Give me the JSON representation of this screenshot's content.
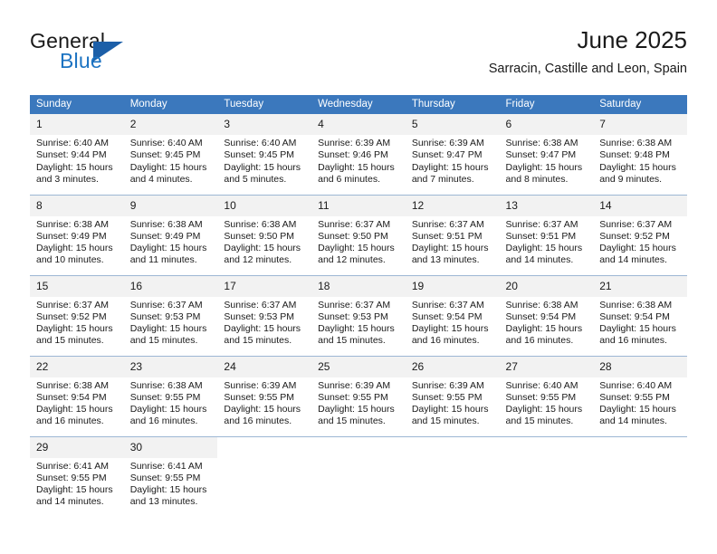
{
  "logo": {
    "word_one": "General",
    "word_two": "Blue",
    "triangle_color": "#1c5fa8",
    "blue_text_color": "#1c73c2"
  },
  "header": {
    "title": "June 2025",
    "subtitle": "Sarracin, Castille and Leon, Spain"
  },
  "theme": {
    "header_bg": "#3b78bd",
    "header_text": "#ffffff",
    "daynum_bg": "#f2f2f2",
    "row_divider": "#9db7d4"
  },
  "calendar": {
    "weekday_headers": [
      "Sunday",
      "Monday",
      "Tuesday",
      "Wednesday",
      "Thursday",
      "Friday",
      "Saturday"
    ],
    "labels": {
      "sunrise_prefix": "Sunrise:",
      "sunset_prefix": "Sunset:",
      "daylight_prefix": "Daylight:"
    },
    "weeks": [
      [
        {
          "day": "1",
          "sunrise": "Sunrise: 6:40 AM",
          "sunset": "Sunset: 9:44 PM",
          "daylight_line1": "Daylight: 15 hours",
          "daylight_line2": "and 3 minutes."
        },
        {
          "day": "2",
          "sunrise": "Sunrise: 6:40 AM",
          "sunset": "Sunset: 9:45 PM",
          "daylight_line1": "Daylight: 15 hours",
          "daylight_line2": "and 4 minutes."
        },
        {
          "day": "3",
          "sunrise": "Sunrise: 6:40 AM",
          "sunset": "Sunset: 9:45 PM",
          "daylight_line1": "Daylight: 15 hours",
          "daylight_line2": "and 5 minutes."
        },
        {
          "day": "4",
          "sunrise": "Sunrise: 6:39 AM",
          "sunset": "Sunset: 9:46 PM",
          "daylight_line1": "Daylight: 15 hours",
          "daylight_line2": "and 6 minutes."
        },
        {
          "day": "5",
          "sunrise": "Sunrise: 6:39 AM",
          "sunset": "Sunset: 9:47 PM",
          "daylight_line1": "Daylight: 15 hours",
          "daylight_line2": "and 7 minutes."
        },
        {
          "day": "6",
          "sunrise": "Sunrise: 6:38 AM",
          "sunset": "Sunset: 9:47 PM",
          "daylight_line1": "Daylight: 15 hours",
          "daylight_line2": "and 8 minutes."
        },
        {
          "day": "7",
          "sunrise": "Sunrise: 6:38 AM",
          "sunset": "Sunset: 9:48 PM",
          "daylight_line1": "Daylight: 15 hours",
          "daylight_line2": "and 9 minutes."
        }
      ],
      [
        {
          "day": "8",
          "sunrise": "Sunrise: 6:38 AM",
          "sunset": "Sunset: 9:49 PM",
          "daylight_line1": "Daylight: 15 hours",
          "daylight_line2": "and 10 minutes."
        },
        {
          "day": "9",
          "sunrise": "Sunrise: 6:38 AM",
          "sunset": "Sunset: 9:49 PM",
          "daylight_line1": "Daylight: 15 hours",
          "daylight_line2": "and 11 minutes."
        },
        {
          "day": "10",
          "sunrise": "Sunrise: 6:38 AM",
          "sunset": "Sunset: 9:50 PM",
          "daylight_line1": "Daylight: 15 hours",
          "daylight_line2": "and 12 minutes."
        },
        {
          "day": "11",
          "sunrise": "Sunrise: 6:37 AM",
          "sunset": "Sunset: 9:50 PM",
          "daylight_line1": "Daylight: 15 hours",
          "daylight_line2": "and 12 minutes."
        },
        {
          "day": "12",
          "sunrise": "Sunrise: 6:37 AM",
          "sunset": "Sunset: 9:51 PM",
          "daylight_line1": "Daylight: 15 hours",
          "daylight_line2": "and 13 minutes."
        },
        {
          "day": "13",
          "sunrise": "Sunrise: 6:37 AM",
          "sunset": "Sunset: 9:51 PM",
          "daylight_line1": "Daylight: 15 hours",
          "daylight_line2": "and 14 minutes."
        },
        {
          "day": "14",
          "sunrise": "Sunrise: 6:37 AM",
          "sunset": "Sunset: 9:52 PM",
          "daylight_line1": "Daylight: 15 hours",
          "daylight_line2": "and 14 minutes."
        }
      ],
      [
        {
          "day": "15",
          "sunrise": "Sunrise: 6:37 AM",
          "sunset": "Sunset: 9:52 PM",
          "daylight_line1": "Daylight: 15 hours",
          "daylight_line2": "and 15 minutes."
        },
        {
          "day": "16",
          "sunrise": "Sunrise: 6:37 AM",
          "sunset": "Sunset: 9:53 PM",
          "daylight_line1": "Daylight: 15 hours",
          "daylight_line2": "and 15 minutes."
        },
        {
          "day": "17",
          "sunrise": "Sunrise: 6:37 AM",
          "sunset": "Sunset: 9:53 PM",
          "daylight_line1": "Daylight: 15 hours",
          "daylight_line2": "and 15 minutes."
        },
        {
          "day": "18",
          "sunrise": "Sunrise: 6:37 AM",
          "sunset": "Sunset: 9:53 PM",
          "daylight_line1": "Daylight: 15 hours",
          "daylight_line2": "and 15 minutes."
        },
        {
          "day": "19",
          "sunrise": "Sunrise: 6:37 AM",
          "sunset": "Sunset: 9:54 PM",
          "daylight_line1": "Daylight: 15 hours",
          "daylight_line2": "and 16 minutes."
        },
        {
          "day": "20",
          "sunrise": "Sunrise: 6:38 AM",
          "sunset": "Sunset: 9:54 PM",
          "daylight_line1": "Daylight: 15 hours",
          "daylight_line2": "and 16 minutes."
        },
        {
          "day": "21",
          "sunrise": "Sunrise: 6:38 AM",
          "sunset": "Sunset: 9:54 PM",
          "daylight_line1": "Daylight: 15 hours",
          "daylight_line2": "and 16 minutes."
        }
      ],
      [
        {
          "day": "22",
          "sunrise": "Sunrise: 6:38 AM",
          "sunset": "Sunset: 9:54 PM",
          "daylight_line1": "Daylight: 15 hours",
          "daylight_line2": "and 16 minutes."
        },
        {
          "day": "23",
          "sunrise": "Sunrise: 6:38 AM",
          "sunset": "Sunset: 9:55 PM",
          "daylight_line1": "Daylight: 15 hours",
          "daylight_line2": "and 16 minutes."
        },
        {
          "day": "24",
          "sunrise": "Sunrise: 6:39 AM",
          "sunset": "Sunset: 9:55 PM",
          "daylight_line1": "Daylight: 15 hours",
          "daylight_line2": "and 16 minutes."
        },
        {
          "day": "25",
          "sunrise": "Sunrise: 6:39 AM",
          "sunset": "Sunset: 9:55 PM",
          "daylight_line1": "Daylight: 15 hours",
          "daylight_line2": "and 15 minutes."
        },
        {
          "day": "26",
          "sunrise": "Sunrise: 6:39 AM",
          "sunset": "Sunset: 9:55 PM",
          "daylight_line1": "Daylight: 15 hours",
          "daylight_line2": "and 15 minutes."
        },
        {
          "day": "27",
          "sunrise": "Sunrise: 6:40 AM",
          "sunset": "Sunset: 9:55 PM",
          "daylight_line1": "Daylight: 15 hours",
          "daylight_line2": "and 15 minutes."
        },
        {
          "day": "28",
          "sunrise": "Sunrise: 6:40 AM",
          "sunset": "Sunset: 9:55 PM",
          "daylight_line1": "Daylight: 15 hours",
          "daylight_line2": "and 14 minutes."
        }
      ],
      [
        {
          "day": "29",
          "sunrise": "Sunrise: 6:41 AM",
          "sunset": "Sunset: 9:55 PM",
          "daylight_line1": "Daylight: 15 hours",
          "daylight_line2": "and 14 minutes."
        },
        {
          "day": "30",
          "sunrise": "Sunrise: 6:41 AM",
          "sunset": "Sunset: 9:55 PM",
          "daylight_line1": "Daylight: 15 hours",
          "daylight_line2": "and 13 minutes."
        },
        {
          "day": "",
          "sunrise": "",
          "sunset": "",
          "daylight_line1": "",
          "daylight_line2": ""
        },
        {
          "day": "",
          "sunrise": "",
          "sunset": "",
          "daylight_line1": "",
          "daylight_line2": ""
        },
        {
          "day": "",
          "sunrise": "",
          "sunset": "",
          "daylight_line1": "",
          "daylight_line2": ""
        },
        {
          "day": "",
          "sunrise": "",
          "sunset": "",
          "daylight_line1": "",
          "daylight_line2": ""
        },
        {
          "day": "",
          "sunrise": "",
          "sunset": "",
          "daylight_line1": "",
          "daylight_line2": ""
        }
      ]
    ]
  }
}
